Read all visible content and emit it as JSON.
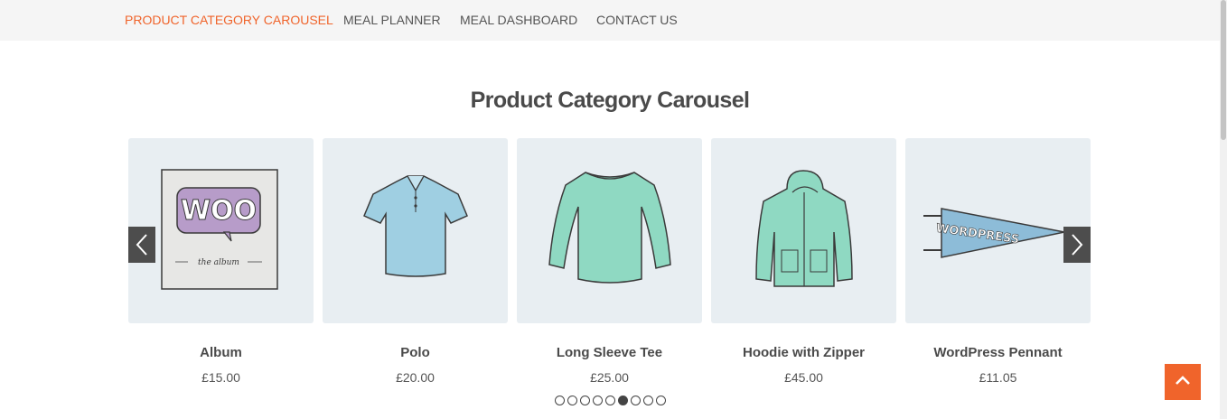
{
  "nav": {
    "items": [
      {
        "label": "PRODUCT CATEGORY CAROUSEL",
        "active": true
      },
      {
        "label": "MEAL PLANNER",
        "active": false
      },
      {
        "label": "MEAL DASHBOARD",
        "active": false
      },
      {
        "label": "CONTACT US",
        "active": false
      }
    ]
  },
  "page": {
    "title": "Product Category Carousel"
  },
  "products": [
    {
      "name": "Album",
      "price": "£15.00",
      "image_text": "WOO",
      "image_subtext": "the album"
    },
    {
      "name": "Polo",
      "price": "£20.00"
    },
    {
      "name": "Long Sleeve Tee",
      "price": "£25.00"
    },
    {
      "name": "Hoodie with Zipper",
      "price": "£45.00"
    },
    {
      "name": "WordPress Pennant",
      "price": "£11.05",
      "image_text": "WORDPRESS"
    }
  ],
  "carousel": {
    "prev_icon": "chevron-left-icon",
    "next_icon": "chevron-right-icon",
    "dot_count": 9,
    "active_dot": 6
  },
  "scroll_top": {
    "icon": "chevron-up-icon"
  },
  "colors": {
    "accent": "#f0642b",
    "nav_bg": "#f5f5f5",
    "card_bg": "#e8eef2",
    "arrow_bg": "#4d4d4d"
  }
}
